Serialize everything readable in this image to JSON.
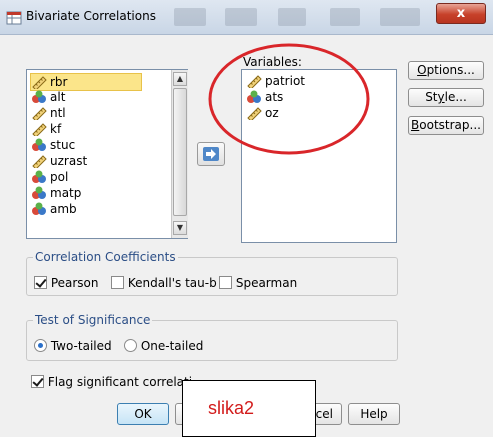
{
  "window": {
    "title": "Bivariate Correlations",
    "close_label": "x"
  },
  "source_list": {
    "items": [
      {
        "label": "rbr",
        "icon": "scale-ruler-icon",
        "selected": true
      },
      {
        "label": "alt",
        "icon": "nominal-people-icon"
      },
      {
        "label": "ntl",
        "icon": "scale-ruler-icon"
      },
      {
        "label": "kf",
        "icon": "scale-ruler-icon"
      },
      {
        "label": "stuc",
        "icon": "nominal-people-icon"
      },
      {
        "label": "uzrast",
        "icon": "scale-ruler-icon"
      },
      {
        "label": "pol",
        "icon": "nominal-people-icon"
      },
      {
        "label": "matp",
        "icon": "nominal-people-icon"
      },
      {
        "label": "amb",
        "icon": "nominal-people-icon"
      }
    ]
  },
  "move_button": {
    "icon": "move-right-arrow-icon"
  },
  "variables": {
    "label": "Variables:",
    "items": [
      {
        "label": "patriot",
        "icon": "scale-ruler-icon"
      },
      {
        "label": "ats",
        "icon": "nominal-people-icon"
      },
      {
        "label": "oz",
        "icon": "scale-ruler-icon"
      }
    ]
  },
  "side_buttons": {
    "options": "Options...",
    "style": "Style...",
    "bootstrap": "Bootstrap..."
  },
  "correlation": {
    "legend": "Correlation Coefficients",
    "pearson": "Pearson",
    "kendall": "Kendall's tau-b",
    "spearman": "Spearman"
  },
  "significance": {
    "legend": "Test of Significance",
    "two_tailed": "Two-tailed",
    "one_tailed": "One-tailed"
  },
  "flag_label": "Flag significant correlati",
  "bottom_buttons": {
    "ok": "OK",
    "paste_partial": "P",
    "cancel_partial": "ncel",
    "help": "Help"
  },
  "annotation": {
    "text": "slika2",
    "ellipse_color": "#d9262a"
  },
  "colors": {
    "selected_item": "#fbe58a",
    "legend_text": "#2b4e86",
    "primary_button_border": "#3c7fb1"
  }
}
